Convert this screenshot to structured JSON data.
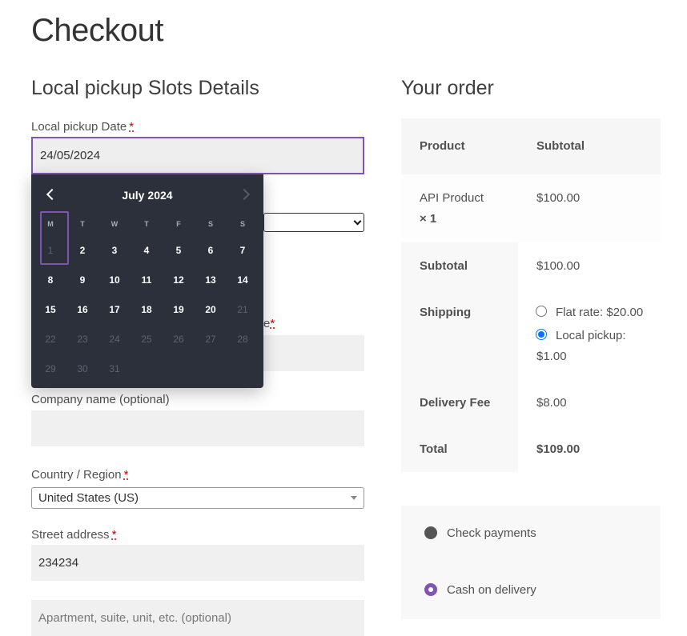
{
  "page": {
    "title": "Checkout"
  },
  "pickup": {
    "section_title": "Local pickup Slots Details",
    "date_label": "Local pickup Date",
    "required_mark": "*",
    "date_value": "24/05/2024",
    "partial_label_tail": "e"
  },
  "datepicker": {
    "month": "July",
    "year": "2024",
    "weekdays": [
      "M",
      "T",
      "W",
      "T",
      "F",
      "S",
      "S"
    ],
    "days": [
      {
        "d": "1",
        "disabled": true
      },
      {
        "d": "2"
      },
      {
        "d": "3"
      },
      {
        "d": "4"
      },
      {
        "d": "5"
      },
      {
        "d": "6"
      },
      {
        "d": "7"
      },
      {
        "d": "8"
      },
      {
        "d": "9"
      },
      {
        "d": "10"
      },
      {
        "d": "11"
      },
      {
        "d": "12"
      },
      {
        "d": "13"
      },
      {
        "d": "14"
      },
      {
        "d": "15"
      },
      {
        "d": "16"
      },
      {
        "d": "17"
      },
      {
        "d": "18"
      },
      {
        "d": "19"
      },
      {
        "d": "20"
      },
      {
        "d": "21",
        "disabled": true
      },
      {
        "d": "22",
        "disabled": true
      },
      {
        "d": "23",
        "disabled": true
      },
      {
        "d": "24",
        "disabled": true
      },
      {
        "d": "25",
        "disabled": true
      },
      {
        "d": "26",
        "disabled": true
      },
      {
        "d": "27",
        "disabled": true
      },
      {
        "d": "28",
        "disabled": true
      },
      {
        "d": "29",
        "disabled": true
      },
      {
        "d": "30",
        "disabled": true
      },
      {
        "d": "31",
        "disabled": true
      }
    ]
  },
  "billing": {
    "company_label": "Company name (optional)",
    "country_label": "Country / Region",
    "country_value": "United States (US)",
    "street_label": "Street address",
    "street_value": "234234",
    "apartment_placeholder": "Apartment, suite, unit, etc. (optional)"
  },
  "order": {
    "section_title": "Your order",
    "col_product": "Product",
    "col_subtotal": "Subtotal",
    "item_name": "API Product",
    "item_qty": "× 1",
    "item_price": "$100.00",
    "subtotal_label": "Subtotal",
    "subtotal_value": "$100.00",
    "shipping_label": "Shipping",
    "shipping_flat": "Flat rate: $20.00",
    "shipping_local_line1": "Local pickup:",
    "shipping_local_line2": "$1.00",
    "fee_label": "Delivery Fee",
    "fee_value": "$8.00",
    "total_label": "Total",
    "total_value": "$109.00"
  },
  "payment": {
    "check_label": "Check payments",
    "cod_label": "Cash on delivery"
  },
  "colors": {
    "accent": "#7f54b3",
    "calendar_bg": "#2b303b",
    "radio_blue": "#0075ff"
  }
}
